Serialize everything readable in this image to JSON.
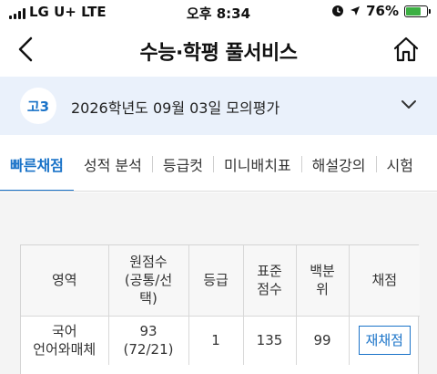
{
  "status_bar": {
    "carrier": "LG U+  LTE",
    "time": "오후 8:34",
    "battery_percent": "76%",
    "battery_level": 0.76,
    "battery_color": "#3cb043"
  },
  "header": {
    "title": "수능·학평 풀서비스",
    "back_icon": "chevron-left-icon",
    "home_icon": "home-icon"
  },
  "exam_selector": {
    "grade_badge": "고3",
    "exam_name": "2026학년도 09월 03일 모의평가",
    "chevron_icon": "chevron-down-icon"
  },
  "tabs": [
    {
      "label": "빠른채점",
      "active": true
    },
    {
      "label": "성적 분석",
      "active": false
    },
    {
      "label": "등급컷",
      "active": false
    },
    {
      "label": "미니배치표",
      "active": false
    },
    {
      "label": "해설강의",
      "active": false
    },
    {
      "label": "시험",
      "active": false
    }
  ],
  "score_table": {
    "headers": {
      "subject": "영역",
      "raw_line1": "원점수",
      "raw_line2": "(공통/선",
      "raw_line3": "택)",
      "grade": "등급",
      "standard_line1": "표준",
      "standard_line2": "점수",
      "percentile_line1": "백분",
      "percentile_line2": "위",
      "rescore": "채점"
    },
    "rows": [
      {
        "subject_line1": "국어",
        "subject_line2": "언어와매체",
        "raw_total": "93",
        "raw_breakdown": "(72/21)",
        "grade": "1",
        "standard": "135",
        "percentile": "99",
        "rescore_label": "재채점"
      }
    ]
  },
  "colors": {
    "accent": "#1a73c8",
    "exam_bar_bg": "#eaf1fb",
    "content_bg": "#f4f4f4"
  }
}
